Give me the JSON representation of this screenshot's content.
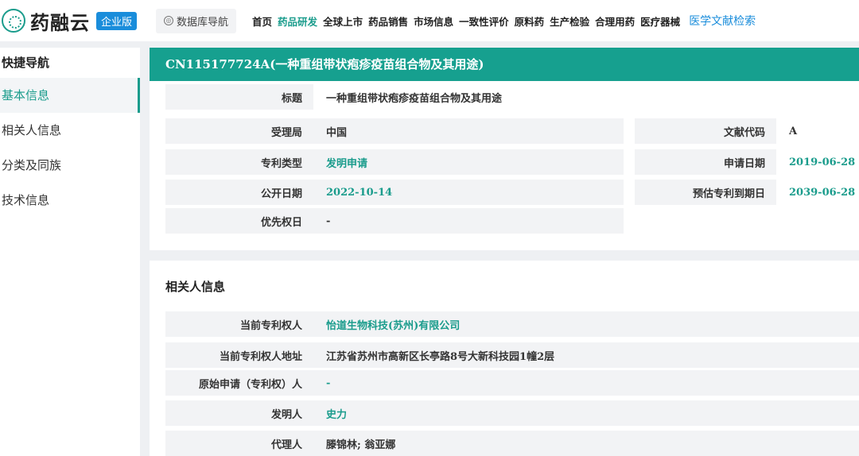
{
  "topbar": {
    "logo_text": "药融云",
    "badge": "企业版",
    "db_nav": "数据库导航",
    "menu": [
      "首页",
      "药品研发",
      "全球上市",
      "药品销售",
      "市场信息",
      "一致性评价",
      "原料药",
      "生产检验",
      "合理用药",
      "医疗器械"
    ],
    "active_menu_index": 1,
    "literature": "医学文献检索"
  },
  "sidebar": {
    "title": "快捷导航",
    "items": [
      {
        "label": "基本信息",
        "active": true
      },
      {
        "label": "相关人信息",
        "active": false
      },
      {
        "label": "分类及同族",
        "active": false
      },
      {
        "label": "技术信息",
        "active": false
      }
    ]
  },
  "basic": {
    "header": "CN115177724A(一种重组带状疱疹疫苗组合物及其用途)",
    "title_label": "标题",
    "title_value": "一种重组带状疱疹疫苗组合物及其用途",
    "office_label": "受理局",
    "office_value": "中国",
    "doc_code_label": "文献代码",
    "doc_code_value": "A",
    "type_label": "专利类型",
    "type_value": "发明申请",
    "apply_date_label": "申请日期",
    "apply_date_value": "2019-06-28",
    "pub_date_label": "公开日期",
    "pub_date_value": "2022-10-14",
    "expiry_label": "预估专利到期日",
    "expiry_value": "2039-06-28",
    "priority_label": "优先权日",
    "priority_value": "-"
  },
  "people": {
    "title": "相关人信息",
    "owner_label": "当前专利权人",
    "owner_value": "怡道生物科技(苏州)有限公司",
    "address_label": "当前专利权人地址",
    "address_value": "江苏省苏州市高新区长亭路8号大新科技园1幢2层",
    "orig_label": "原始申请（专利权）人",
    "orig_value": "-",
    "inventor_label": "发明人",
    "inventor_value": "史力",
    "agent_label": "代理人",
    "agent_value": "滕锦林; 翁亚娜"
  }
}
